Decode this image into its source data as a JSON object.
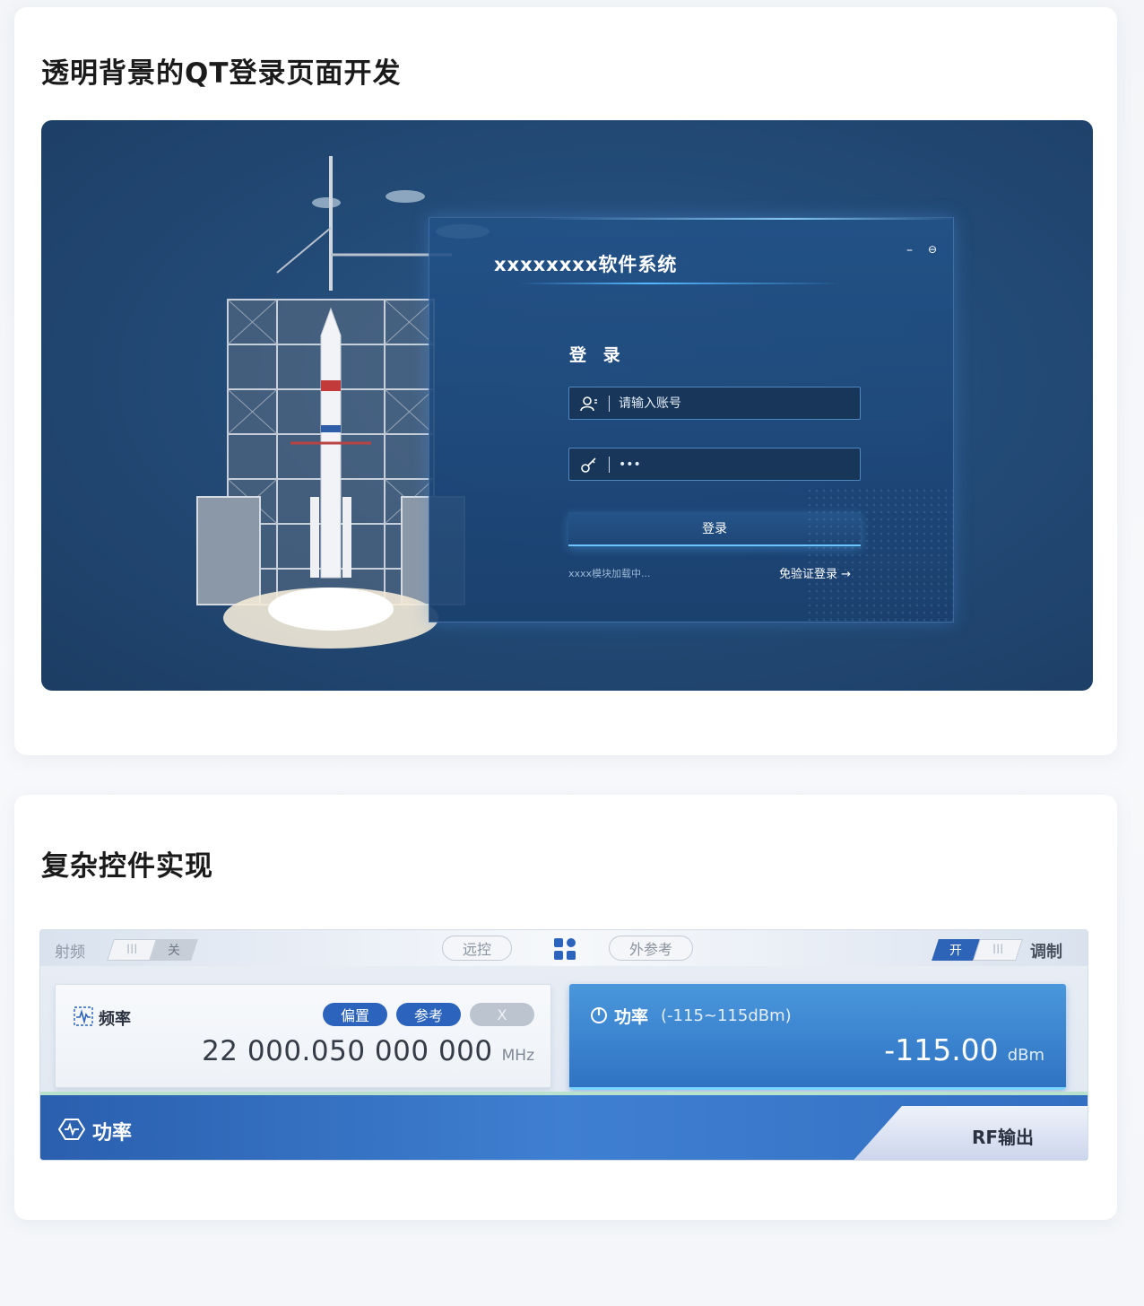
{
  "sections": {
    "login_title": "透明背景的QT登录页面开发",
    "control_title": "复杂控件实现"
  },
  "login": {
    "system_name": "xxxxxxxx软件系统",
    "heading": "登 录",
    "username_placeholder": "请输入账号",
    "password_value": "•••",
    "login_button": "登录",
    "loading_text": "xxxx模块加载中...",
    "free_login": "免验证登录 →",
    "minimize_glyph": "–",
    "exit_glyph": "⊖"
  },
  "control": {
    "rf_label": "射频",
    "rf_toggle_grip": "III",
    "rf_toggle_state": "关",
    "remote_pill": "远控",
    "ext_ref_pill": "外参考",
    "mod_toggle_state": "开",
    "mod_toggle_grip": "III",
    "mod_label": "调制",
    "frequency": {
      "label": "频率",
      "tags": [
        "偏置",
        "参考",
        "X"
      ],
      "value": "22 000.050 000 000",
      "unit": "MHz"
    },
    "power": {
      "label": "功率",
      "range": "(-115~115dBm)",
      "value": "-115.00",
      "unit": "dBm"
    },
    "bottom_label": "功率",
    "rf_output": "RF输出"
  },
  "colors": {
    "login_bg": "#234b77",
    "accent_blue": "#2b63bd",
    "power_box": "#3a83cf"
  }
}
